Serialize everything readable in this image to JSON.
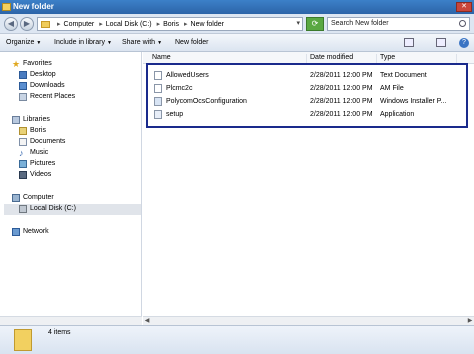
{
  "window": {
    "title": "New folder"
  },
  "address": {
    "crumbs": [
      "Computer",
      "Local Disk (C:)",
      "Boris",
      "New folder"
    ],
    "search_placeholder": "Search New folder"
  },
  "toolbar": {
    "organize": "Organize",
    "include": "Include in library",
    "share": "Share with",
    "new_folder": "New folder"
  },
  "sidebar": {
    "favorites": "Favorites",
    "desktop": "Desktop",
    "downloads": "Downloads",
    "recent": "Recent Places",
    "libraries": "Libraries",
    "boris": "Boris",
    "documents": "Documents",
    "music": "Music",
    "pictures": "Pictures",
    "videos": "Videos",
    "computer": "Computer",
    "localdisk": "Local Disk (C:)",
    "network": "Network"
  },
  "columns": {
    "name": "Name",
    "date": "Date modified",
    "type": "Type"
  },
  "files": [
    {
      "name": "AllowedUsers",
      "date": "2/28/2011 12:00 PM",
      "type": "Text Document"
    },
    {
      "name": "Plcmc2c",
      "date": "2/28/2011 12:00 PM",
      "type": "AM File"
    },
    {
      "name": "PolycomOcsConfiguration",
      "date": "2/28/2011 12:00 PM",
      "type": "Windows Installer P..."
    },
    {
      "name": "setup",
      "date": "2/28/2011 12:00 PM",
      "type": "Application"
    }
  ],
  "status": {
    "items": "4 items"
  }
}
